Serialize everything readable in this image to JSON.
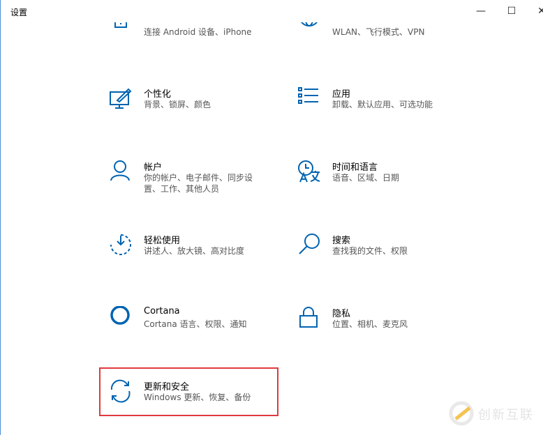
{
  "window": {
    "title": "设置",
    "minimize": "—",
    "maximize": "☐",
    "close": "✕"
  },
  "items": [
    {
      "title": "",
      "subtitle": "连接 Android 设备、iPhone",
      "icon": "phone-icon"
    },
    {
      "title": "",
      "subtitle": "WLAN、飞行模式、VPN",
      "icon": "globe-icon"
    },
    {
      "title": "个性化",
      "subtitle": "背景、锁屏、颜色",
      "icon": "personalization-icon"
    },
    {
      "title": "应用",
      "subtitle": "卸载、默认应用、可选功能",
      "icon": "apps-list-icon"
    },
    {
      "title": "帐户",
      "subtitle": "你的帐户、电子邮件、同步设置、工作、其他人员",
      "icon": "person-icon"
    },
    {
      "title": "时间和语言",
      "subtitle": "语音、区域、日期",
      "icon": "time-language-icon"
    },
    {
      "title": "轻松使用",
      "subtitle": "讲述人、放大镜、高对比度",
      "icon": "ease-of-access-icon"
    },
    {
      "title": "搜索",
      "subtitle": "查找我的文件、权限",
      "icon": "search-icon"
    },
    {
      "title": "Cortana",
      "subtitle": "Cortana 语言、权限、通知",
      "icon": "cortana-icon"
    },
    {
      "title": "隐私",
      "subtitle": "位置、相机、麦克风",
      "icon": "lock-icon"
    },
    {
      "title": "更新和安全",
      "subtitle": "Windows 更新、恢复、备份",
      "icon": "update-icon"
    }
  ],
  "highlight_color": "#e0393e",
  "accent": "#0063b1",
  "watermark": "创新互联"
}
